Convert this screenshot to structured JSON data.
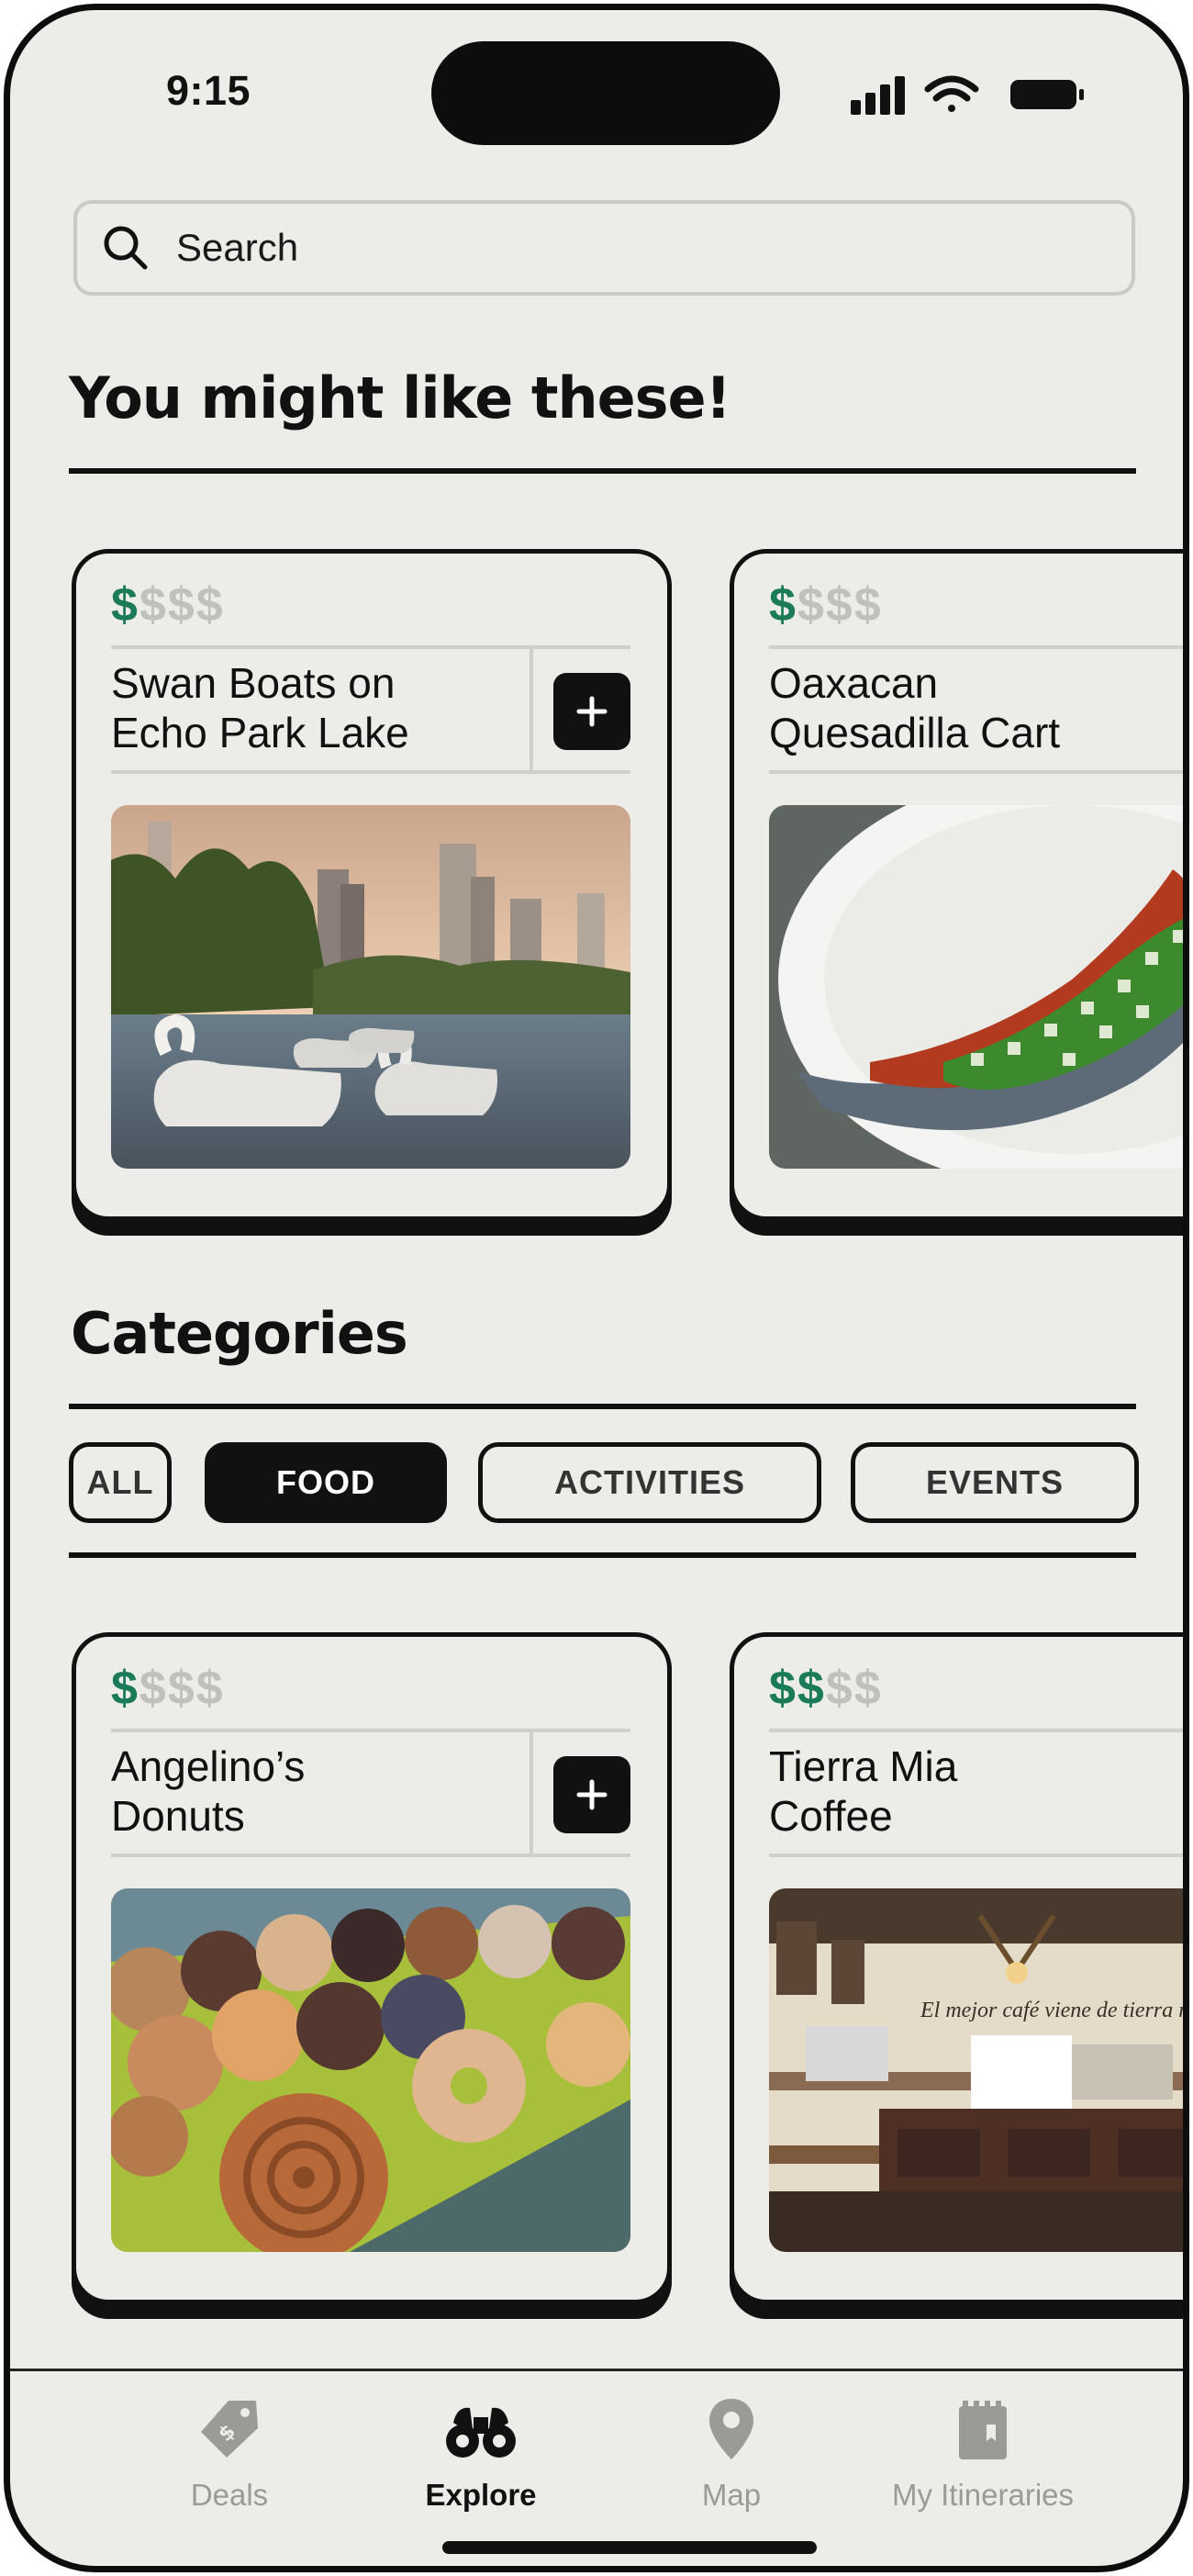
{
  "status_bar": {
    "time": "9:15"
  },
  "search": {
    "placeholder": "Search"
  },
  "recommendations": {
    "heading": "You might like these!",
    "cards": [
      {
        "price_active": "$",
        "price_inactive": "$$$",
        "title": "Swan Boats on\nEcho Park Lake",
        "add_label": "+"
      },
      {
        "price_active": "$",
        "price_inactive": "$$$",
        "title": "Oaxacan\nQuesadilla Cart",
        "add_label": "+"
      }
    ]
  },
  "categories": {
    "heading": "Categories",
    "chips": [
      {
        "label": "ALL",
        "selected": false
      },
      {
        "label": "FOOD",
        "selected": true
      },
      {
        "label": "ACTIVITIES",
        "selected": false
      },
      {
        "label": "EVENTS",
        "selected": false
      }
    ],
    "cards": [
      {
        "price_active": "$",
        "price_inactive": "$$$",
        "title": "Angelino’s\nDonuts",
        "add_label": "+"
      },
      {
        "price_active": "$$",
        "price_inactive": "$$",
        "title": "Tierra Mia\nCoffee",
        "add_label": "+",
        "photo_caption": "El mejor café viene de tierra mía"
      }
    ]
  },
  "tab_bar": {
    "tabs": [
      {
        "label": "Deals",
        "icon": "price-tag-icon",
        "active": false
      },
      {
        "label": "Explore",
        "icon": "binoculars-icon",
        "active": true
      },
      {
        "label": "Map",
        "icon": "map-pin-icon",
        "active": false
      },
      {
        "label": "My Itineraries",
        "icon": "notebook-icon",
        "active": false
      }
    ]
  },
  "colors": {
    "background": "#ecede8",
    "price_active": "#1b7a58",
    "price_inactive": "#c0c1bd",
    "ink": "#111111"
  }
}
